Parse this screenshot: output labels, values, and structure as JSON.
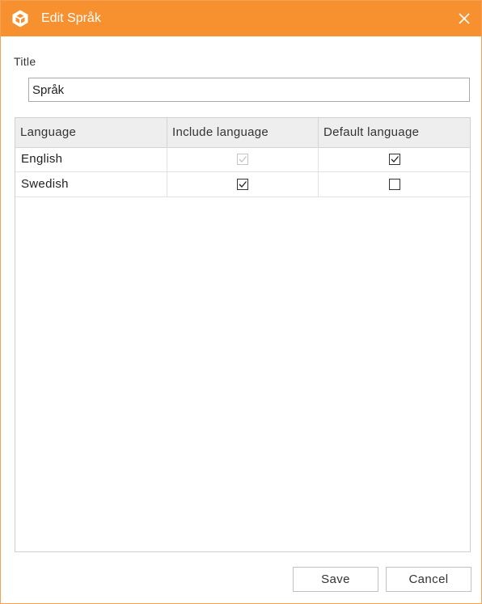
{
  "window": {
    "title": "Edit Språk",
    "accent_color": "#f7912f",
    "app_icon": "box-logo-icon",
    "close_icon": "close-icon"
  },
  "form": {
    "title_label": "Title",
    "title_value": "Språk"
  },
  "table": {
    "columns": [
      "Language",
      "Include language",
      "Default language"
    ],
    "rows": [
      {
        "language": "English",
        "include": true,
        "include_disabled": true,
        "default": true
      },
      {
        "language": "Swedish",
        "include": true,
        "include_disabled": false,
        "default": false
      }
    ]
  },
  "buttons": {
    "save": "Save",
    "cancel": "Cancel"
  }
}
